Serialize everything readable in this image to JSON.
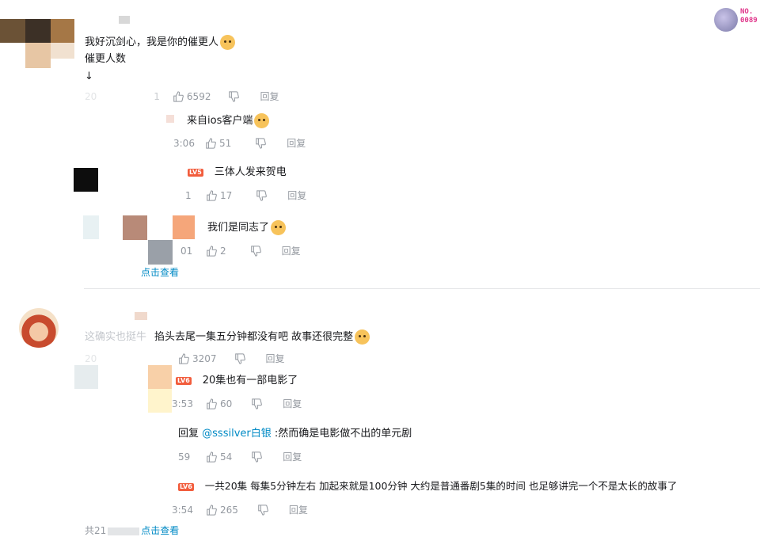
{
  "badge": {
    "line1": "NO.",
    "line2": "0089"
  },
  "thread1": {
    "comment_line1": "我好沉剑心，我是你的催更人",
    "comment_line2": "催更人数",
    "comment_line3": "↓",
    "date_prefix": "20",
    "date_suffix": "1",
    "likes": "6592",
    "reply_label": "回复",
    "replies": [
      {
        "text": "来自ios客户端",
        "time": "3:06",
        "likes": "51",
        "reply_label": "回复"
      },
      {
        "level": "LV5",
        "text": "三体人发来贺电",
        "time": "1",
        "likes": "17",
        "reply_label": "回复"
      },
      {
        "text": "我们是同志了",
        "time": "01",
        "likes": "2",
        "reply_label": "回复"
      }
    ],
    "more_text": "点击查看"
  },
  "thread2": {
    "comment_prefix": "这确实也挺牛",
    "comment_text": "掐头去尾一集五分钟都没有吧 故事还很完整",
    "date_prefix": "20",
    "likes": "3207",
    "reply_label": "回复",
    "replies": [
      {
        "level": "LV6",
        "text": "20集也有一部电影了",
        "time": "3:53",
        "likes": "60",
        "reply_label": "回复"
      },
      {
        "reply_word": "回复",
        "mention": "@sssilver白银",
        "text": ":然而确是电影做不出的单元剧",
        "time": "59",
        "likes": "54",
        "reply_label": "回复"
      },
      {
        "level": "LV6",
        "text": "一共20集 每集5分钟左右 加起来就是100分钟 大约是普通番剧5集的时间 也足够讲完一个不是太长的故事了",
        "time": "3:54",
        "likes": "265",
        "reply_label": "回复"
      }
    ],
    "more_prefix": "共21",
    "more_text": "点击查看"
  },
  "colors": {
    "text": "#18191c",
    "meta": "#9499a0",
    "link": "#008ac5",
    "level": "#f25d3d"
  }
}
